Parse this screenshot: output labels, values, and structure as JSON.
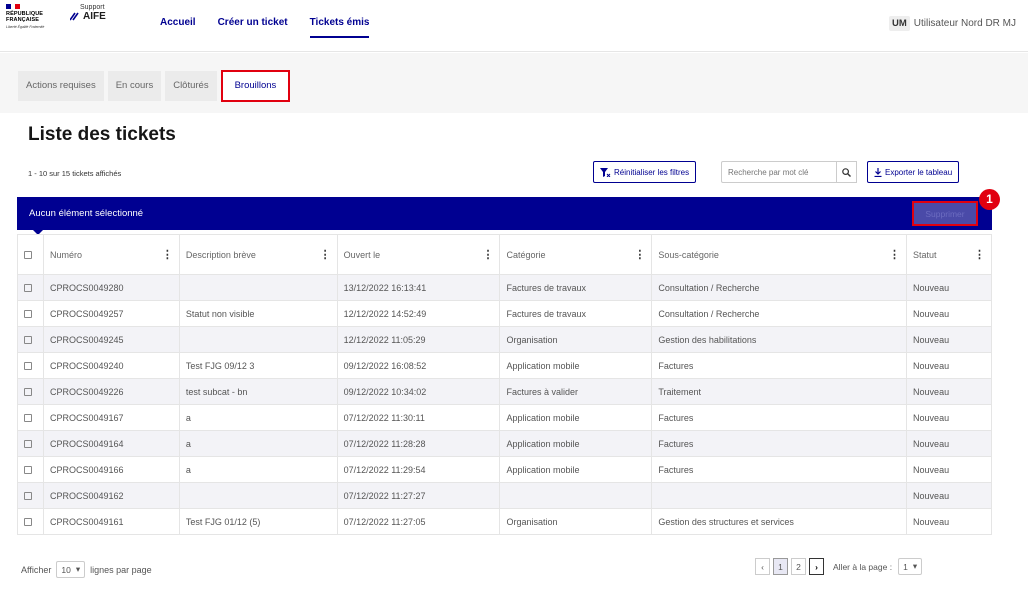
{
  "header": {
    "rf_lines": [
      "RÉPUBLIQUE",
      "FRANÇAISE"
    ],
    "rf_motto": "Liberté Égalité Fraternité",
    "brand_top": "Support",
    "brand_main": "AIFE",
    "nav": [
      "Accueil",
      "Créer un ticket",
      "Tickets émis"
    ],
    "user_initials": "UM",
    "user_name": "Utilisateur Nord DR MJ"
  },
  "tabs": [
    "Actions requises",
    "En cours",
    "Clôturés",
    "Brouillons"
  ],
  "page_title": "Liste des tickets",
  "toolbar": {
    "count": "1 - 10 sur 15 tickets affichés",
    "reset_filters": "Réinitialiser les filtres",
    "search_placeholder": "Recherche par mot clé",
    "export": "Exporter le tableau"
  },
  "selection_bar": {
    "text": "Aucun élément sélectionné",
    "delete": "Supprimer",
    "badge": "1"
  },
  "table": {
    "columns": [
      "Numéro",
      "Description brève",
      "Ouvert le",
      "Catégorie",
      "Sous-catégorie",
      "Statut"
    ],
    "rows": [
      [
        "CPROCS0049280",
        "",
        "13/12/2022 16:13:41",
        "Factures de travaux",
        "Consultation / Recherche",
        "Nouveau"
      ],
      [
        "CPROCS0049257",
        "Statut non visible",
        "12/12/2022 14:52:49",
        "Factures de travaux",
        "Consultation / Recherche",
        "Nouveau"
      ],
      [
        "CPROCS0049245",
        "",
        "12/12/2022 11:05:29",
        "Organisation",
        "Gestion des habilitations",
        "Nouveau"
      ],
      [
        "CPROCS0049240",
        "Test FJG 09/12 3",
        "09/12/2022 16:08:52",
        "Application mobile",
        "Factures",
        "Nouveau"
      ],
      [
        "CPROCS0049226",
        "test subcat - bn",
        "09/12/2022 10:34:02",
        "Factures à valider",
        "Traitement",
        "Nouveau"
      ],
      [
        "CPROCS0049167",
        "a",
        "07/12/2022 11:30:11",
        "Application mobile",
        "Factures",
        "Nouveau"
      ],
      [
        "CPROCS0049164",
        "a",
        "07/12/2022 11:28:28",
        "Application mobile",
        "Factures",
        "Nouveau"
      ],
      [
        "CPROCS0049166",
        "a",
        "07/12/2022 11:29:54",
        "Application mobile",
        "Factures",
        "Nouveau"
      ],
      [
        "CPROCS0049162",
        "",
        "07/12/2022 11:27:27",
        "",
        "",
        "Nouveau"
      ],
      [
        "CPROCS0049161",
        "Test FJG 01/12 (5)",
        "07/12/2022 11:27:05",
        "Organisation",
        "Gestion des structures et services",
        "Nouveau"
      ]
    ]
  },
  "footer": {
    "show_label": "Afficher",
    "per_page": "10",
    "per_page_suffix": "lignes par page",
    "pages": [
      "1",
      "2"
    ],
    "goto_label": "Aller à la page :",
    "goto_value": "1"
  },
  "colors": {
    "primary": "#000091",
    "highlight": "#e1000f"
  }
}
